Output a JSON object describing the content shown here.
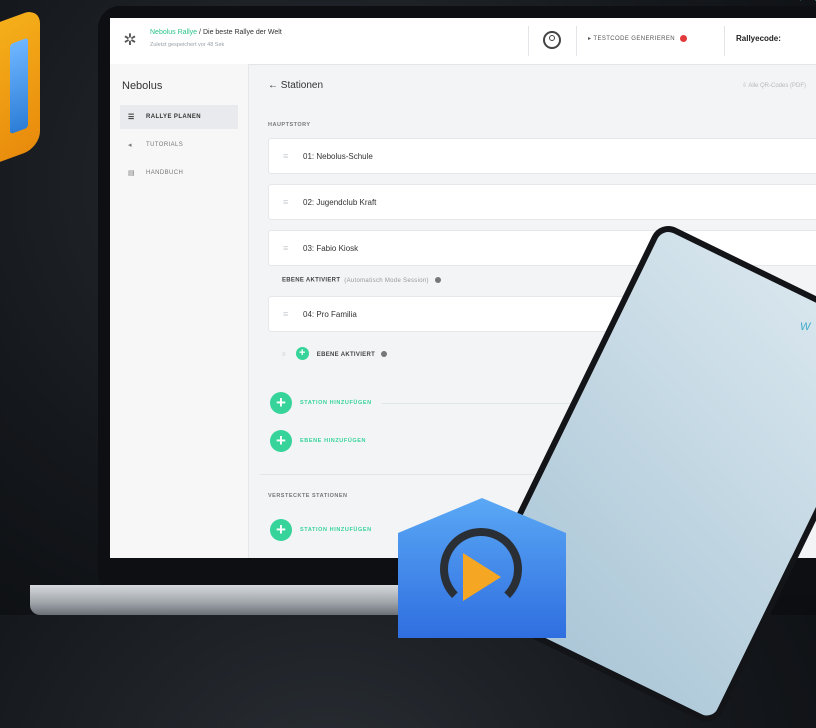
{
  "topbar": {
    "breadcrumb_link": "Nebolus Rallye",
    "breadcrumb_sep": "/",
    "breadcrumb_current": "Die beste Rallye der Welt",
    "subtitle": "Zuletzt gespeichert vor 48 Sek",
    "generate_label": "TESTCODE GENERIEREN",
    "rally_code_label": "Rallyecode:"
  },
  "sidebar": {
    "brand": "Nebolus",
    "items": [
      {
        "label": "RALLYE PLANEN",
        "icon": "list-icon"
      },
      {
        "label": "TUTORIALS",
        "icon": "arrow-icon"
      },
      {
        "label": "HANDBUCH",
        "icon": "book-icon"
      }
    ]
  },
  "main": {
    "back_title": "← Stationen",
    "export_label": "Alle QR-Codes (PDF)",
    "section_main": "HAUPTSTORY",
    "stations": [
      "01: Nebolus-Schule",
      "02: Jugendclub Kraft",
      "03: Fabio Kiosk",
      "04: Pro Familia"
    ],
    "level_info": "EBENE AKTIVIERT",
    "level_info_note": "(Automatisch Mode Session)",
    "level_sub": "EBENE AKTIVIERT",
    "add_station": "STATION HINZUFÜGEN",
    "add_level": "EBENE HINZUFÜGEN",
    "section_hidden": "VERSTECKTE STATIONEN",
    "add_station_hidden": "STATION HINZUFÜGEN"
  },
  "tablet": {
    "label": "W"
  },
  "colors": {
    "accent": "#36d49a",
    "danger": "#e23a3a",
    "badge": "#f6b21b"
  }
}
